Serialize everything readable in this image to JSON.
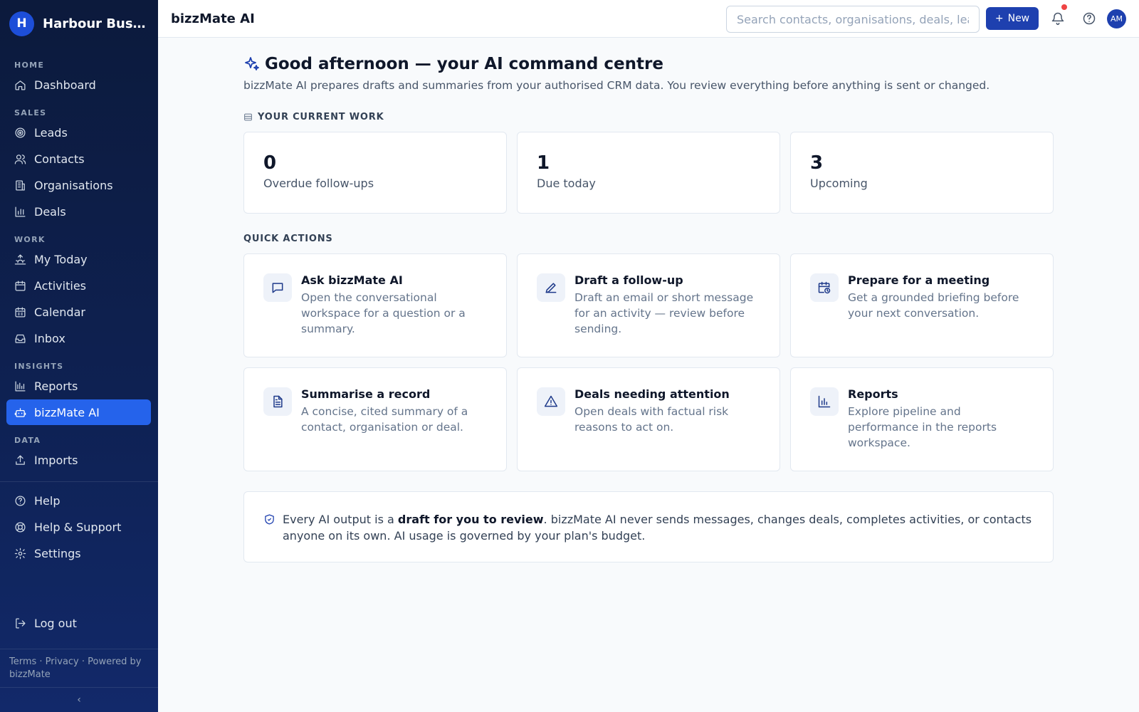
{
  "brand": {
    "initial": "H",
    "name": "Harbour Business"
  },
  "topbar": {
    "title": "bizzMate AI",
    "search_placeholder": "Search contacts, organisations, deals, leads",
    "new_label": "New",
    "avatar_initials": "AM"
  },
  "sidebar": {
    "sections": {
      "home": "HOME",
      "sales": "SALES",
      "work": "WORK",
      "insights": "INSIGHTS",
      "data": "DATA"
    },
    "items": {
      "dashboard": "Dashboard",
      "leads": "Leads",
      "contacts": "Contacts",
      "organisations": "Organisations",
      "deals": "Deals",
      "my_today": "My Today",
      "activities": "Activities",
      "calendar": "Calendar",
      "inbox": "Inbox",
      "reports": "Reports",
      "bizzmate_ai": "bizzMate AI",
      "imports": "Imports",
      "help": "Help",
      "help_support": "Help & Support",
      "settings": "Settings",
      "log_out": "Log out"
    },
    "active": "bizzmate_ai",
    "footer": "Terms · Privacy · Powered by bizzMate",
    "collapse_glyph": "‹"
  },
  "main": {
    "title": "Good afternoon — your AI command centre",
    "subtitle": "bizzMate AI prepares drafts and summaries from your authorised CRM data. You review everything before anything is sent or changed.",
    "current_work_label": "YOUR CURRENT WORK",
    "stats": [
      {
        "value": "0",
        "label": "Overdue follow-ups"
      },
      {
        "value": "1",
        "label": "Due today"
      },
      {
        "value": "3",
        "label": "Upcoming"
      }
    ],
    "quick_actions_label": "QUICK ACTIONS",
    "quick_actions": [
      {
        "icon": "chat-icon",
        "title": "Ask bizzMate AI",
        "desc": "Open the conversational workspace for a question or a summary."
      },
      {
        "icon": "pencil-icon",
        "title": "Draft a follow-up",
        "desc": "Draft an email or short message for an activity — review before sending."
      },
      {
        "icon": "calendar-clock-icon",
        "title": "Prepare for a meeting",
        "desc": "Get a grounded briefing before your next conversation."
      },
      {
        "icon": "document-icon",
        "title": "Summarise a record",
        "desc": "A concise, cited summary of a contact, organisation or deal."
      },
      {
        "icon": "warning-icon",
        "title": "Deals needing attention",
        "desc": "Open deals with factual risk reasons to act on."
      },
      {
        "icon": "bar-chart-icon",
        "title": "Reports",
        "desc": "Explore pipeline and performance in the reports workspace."
      }
    ],
    "notice": {
      "prefix": "Every AI output is a ",
      "bold": "draft for you to review",
      "suffix": ". bizzMate AI never sends messages, changes deals, completes activities, or contacts anyone on its own. AI usage is governed by your plan's budget."
    }
  },
  "colors": {
    "accent": "#1e40af",
    "active_nav": "#2563eb",
    "sidebar_bg": "#0c1a3c",
    "notification": "#ef4444"
  }
}
